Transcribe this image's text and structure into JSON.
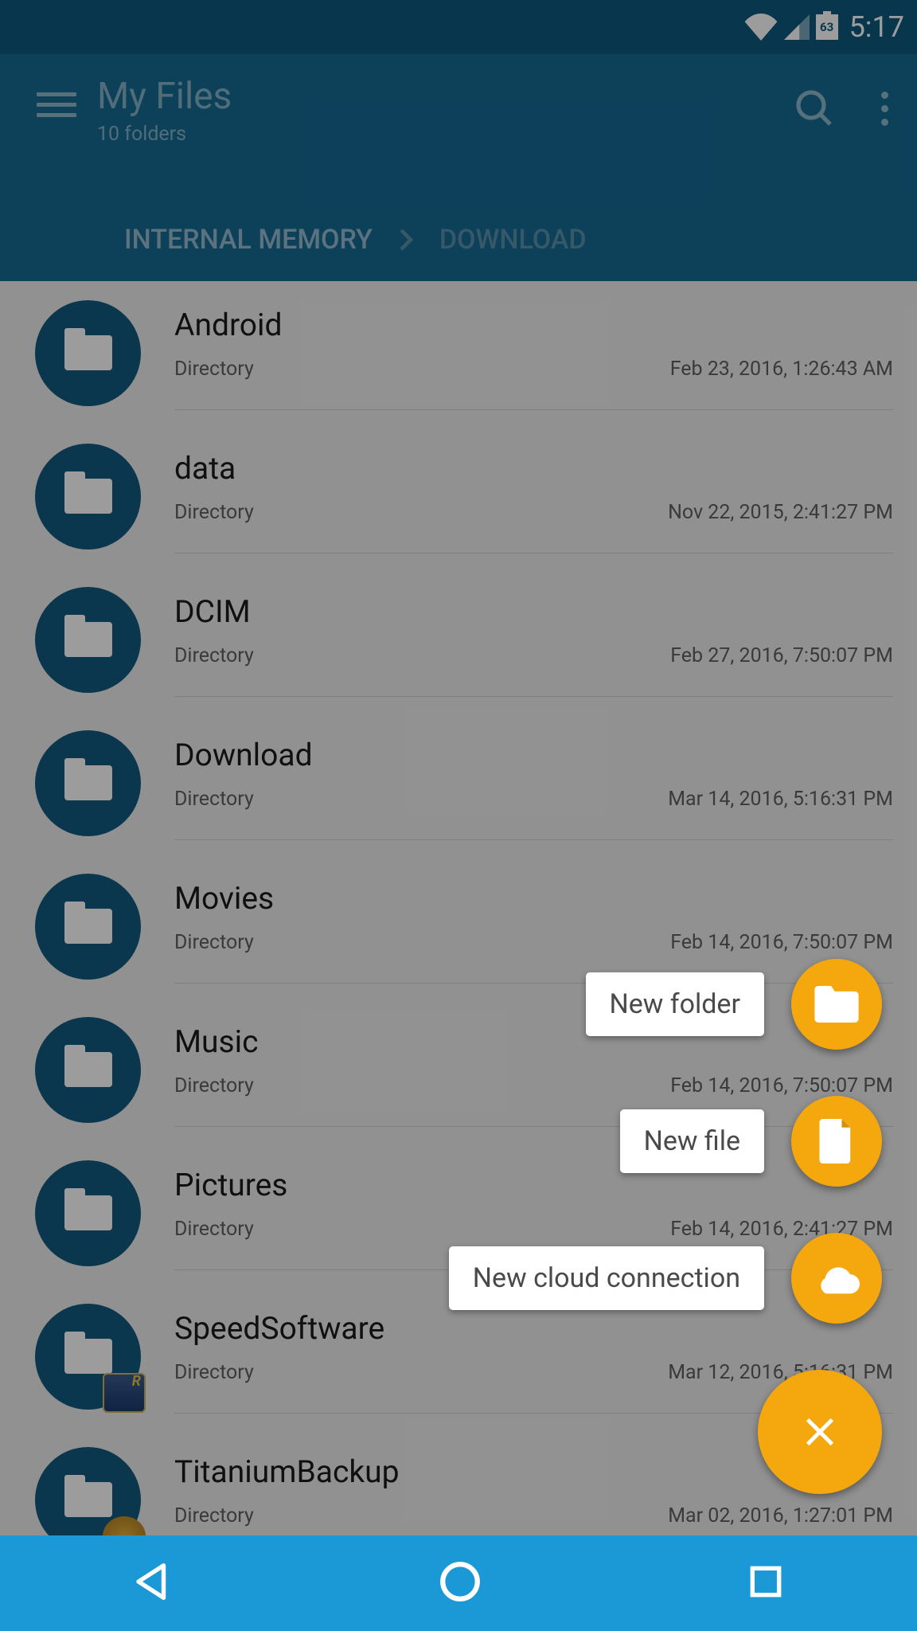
{
  "status": {
    "battery": "63",
    "time": "5:17"
  },
  "appbar": {
    "title": "My Files",
    "subtitle": "10 folders"
  },
  "breadcrumb": {
    "items": [
      "INTERNAL MEMORY",
      "DOWNLOAD"
    ]
  },
  "list": [
    {
      "name": "Android",
      "type": "Directory",
      "date": "Feb 23, 2016, 1:26:43 AM",
      "overlay": null
    },
    {
      "name": "data",
      "type": "Directory",
      "date": "Nov 22, 2015, 2:41:27 PM",
      "overlay": null
    },
    {
      "name": "DCIM",
      "type": "Directory",
      "date": "Feb 27, 2016, 7:50:07 PM",
      "overlay": null
    },
    {
      "name": "Download",
      "type": "Directory",
      "date": "Mar 14, 2016, 5:16:31 PM",
      "overlay": null
    },
    {
      "name": "Movies",
      "type": "Directory",
      "date": "Feb 14, 2016, 7:50:07 PM",
      "overlay": null
    },
    {
      "name": "Music",
      "type": "Directory",
      "date": "Feb 14, 2016, 7:50:07 PM",
      "overlay": null
    },
    {
      "name": "Pictures",
      "type": "Directory",
      "date": "Feb 14, 2016, 2:41:27 PM",
      "overlay": null
    },
    {
      "name": "SpeedSoftware",
      "type": "Directory",
      "date": "Mar 12, 2016, 5:16:31 PM",
      "overlay": "a"
    },
    {
      "name": "TitaniumBackup",
      "type": "Directory",
      "date": "Mar 02, 2016, 1:27:01 PM",
      "overlay": "b"
    }
  ],
  "fab": {
    "items": [
      {
        "label": "New folder",
        "icon": "folder"
      },
      {
        "label": "New file",
        "icon": "file"
      },
      {
        "label": "New cloud connection",
        "icon": "cloud"
      }
    ]
  }
}
